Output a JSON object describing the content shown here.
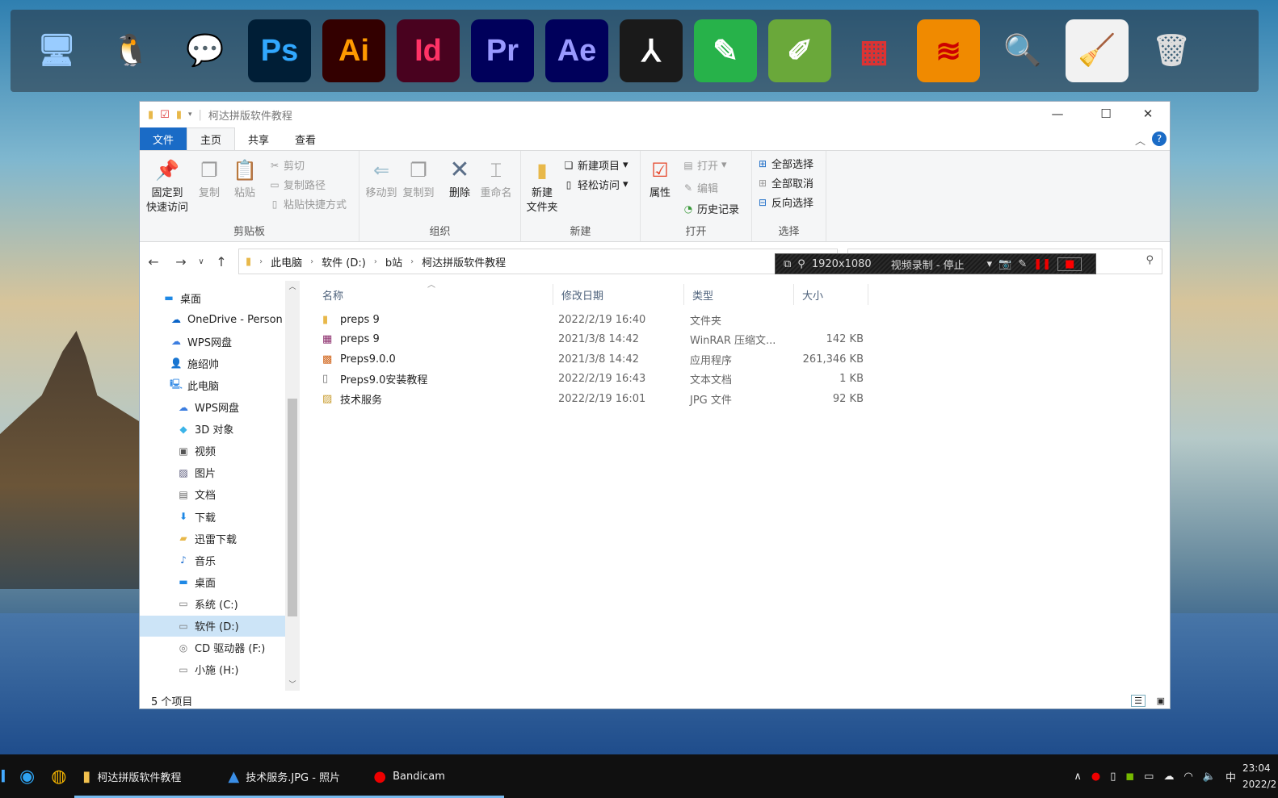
{
  "dock": {
    "icons": [
      {
        "name": "computer-icon",
        "glyph": "🖥",
        "bg": "transparent",
        "fg": "#9cf"
      },
      {
        "name": "qq-icon",
        "glyph": "🐧",
        "bg": "transparent",
        "fg": "#000"
      },
      {
        "name": "wechat-icon",
        "glyph": "💬",
        "bg": "transparent",
        "fg": "#2dc100"
      },
      {
        "name": "photoshop-icon",
        "glyph": "Ps",
        "bg": "#001e36",
        "fg": "#31a8ff"
      },
      {
        "name": "illustrator-icon",
        "glyph": "Ai",
        "bg": "#330000",
        "fg": "#ff9a00"
      },
      {
        "name": "indesign-icon",
        "glyph": "Id",
        "bg": "#49021f",
        "fg": "#ff3366"
      },
      {
        "name": "premiere-icon",
        "glyph": "Pr",
        "bg": "#00005b",
        "fg": "#9999ff"
      },
      {
        "name": "after-effects-icon",
        "glyph": "Ae",
        "bg": "#00005b",
        "fg": "#9999ff"
      },
      {
        "name": "acrobat-icon",
        "glyph": "⅄",
        "bg": "#1a1a1a",
        "fg": "#fff"
      },
      {
        "name": "green-pen-app-icon",
        "glyph": "✎",
        "bg": "#27b24a",
        "fg": "#fff"
      },
      {
        "name": "coreldraw-icon",
        "glyph": "✐",
        "bg": "#6aa83a",
        "fg": "#fff"
      },
      {
        "name": "windows-tiles-icon",
        "glyph": "▦",
        "bg": "transparent",
        "fg": "#d33"
      },
      {
        "name": "painting-app-icon",
        "glyph": "≋",
        "bg": "#f08a00",
        "fg": "#c00"
      },
      {
        "name": "magnifier-icon",
        "glyph": "🔍",
        "bg": "transparent",
        "fg": "#ccc"
      },
      {
        "name": "cleaner-icon",
        "glyph": "🧹",
        "bg": "#f2f2f2",
        "fg": "#6a3"
      },
      {
        "name": "trash-icon",
        "glyph": "🗑",
        "bg": "transparent",
        "fg": "#ddd"
      }
    ]
  },
  "window": {
    "title": "柯达拼版软件教程",
    "tabs": [
      "文件",
      "主页",
      "共享",
      "查看"
    ],
    "ribbon": {
      "clipboard": {
        "label": "剪贴板",
        "pin": "固定到",
        "pin2": "快速访问",
        "copy": "复制",
        "paste": "粘贴",
        "cut": "剪切",
        "copy_path": "复制路径",
        "paste_shortcut": "粘贴快捷方式"
      },
      "organize": {
        "label": "组织",
        "move_to": "移动到",
        "copy_to": "复制到",
        "delete": "删除",
        "rename": "重命名"
      },
      "new": {
        "label": "新建",
        "new_folder": "新建",
        "new_folder2": "文件夹",
        "new_item": "新建项目",
        "easy_access": "轻松访问"
      },
      "open": {
        "label": "打开",
        "properties": "属性",
        "open": "打开",
        "edit": "编辑",
        "history": "历史记录"
      },
      "select": {
        "label": "选择",
        "select_all": "全部选择",
        "select_none": "全部取消",
        "invert": "反向选择"
      }
    },
    "breadcrumb": [
      "此电脑",
      "软件 (D:)",
      "b站",
      "柯达拼版软件教程"
    ],
    "bandicam": {
      "resolution": "1920x1080",
      "status": "视频录制 - 停止"
    },
    "nav": [
      {
        "label": "桌面",
        "icon": "desktop-icon",
        "g": "▬",
        "c": "#1e88e5",
        "indent": 0
      },
      {
        "label": "OneDrive - Person",
        "icon": "onedrive-icon",
        "g": "☁",
        "c": "#0a64c8",
        "indent": 1
      },
      {
        "label": "WPS网盘",
        "icon": "wps-cloud-icon",
        "g": "☁",
        "c": "#3b7de0",
        "indent": 1
      },
      {
        "label": "施绍帅",
        "icon": "user-icon",
        "g": "👤",
        "c": "#d9a441",
        "indent": 1
      },
      {
        "label": "此电脑",
        "icon": "pc-icon",
        "g": "🖳",
        "c": "#3a8ee6",
        "indent": 1
      },
      {
        "label": "WPS网盘",
        "icon": "wps-cloud-icon",
        "g": "☁",
        "c": "#3b7de0",
        "indent": 2
      },
      {
        "label": "3D 对象",
        "icon": "3d-objects-icon",
        "g": "◆",
        "c": "#3bb4e8",
        "indent": 2
      },
      {
        "label": "视频",
        "icon": "videos-icon",
        "g": "▣",
        "c": "#555",
        "indent": 2
      },
      {
        "label": "图片",
        "icon": "pictures-icon",
        "g": "▨",
        "c": "#557",
        "indent": 2
      },
      {
        "label": "文档",
        "icon": "documents-icon",
        "g": "▤",
        "c": "#666",
        "indent": 2
      },
      {
        "label": "下载",
        "icon": "downloads-icon",
        "g": "⬇",
        "c": "#1e88e5",
        "indent": 2
      },
      {
        "label": "迅雷下载",
        "icon": "folder-icon",
        "g": "▰",
        "c": "#e8b84a",
        "indent": 2
      },
      {
        "label": "音乐",
        "icon": "music-icon",
        "g": "♪",
        "c": "#1e6fd0",
        "indent": 2
      },
      {
        "label": "桌面",
        "icon": "desktop-icon",
        "g": "▬",
        "c": "#1e88e5",
        "indent": 2
      },
      {
        "label": "系统 (C:)",
        "icon": "drive-icon",
        "g": "▭",
        "c": "#777",
        "indent": 2
      },
      {
        "label": "软件 (D:)",
        "icon": "drive-icon",
        "g": "▭",
        "c": "#777",
        "indent": 2,
        "selected": true
      },
      {
        "label": "CD 驱动器 (F:)",
        "icon": "cd-drive-icon",
        "g": "◎",
        "c": "#777",
        "indent": 2
      },
      {
        "label": "小施 (H:)",
        "icon": "drive-icon",
        "g": "▭",
        "c": "#777",
        "indent": 2
      }
    ],
    "columns": [
      "名称",
      "修改日期",
      "类型",
      "大小"
    ],
    "files": [
      {
        "name": "preps 9",
        "date": "2022/2/19 16:40",
        "type": "文件夹",
        "size": "",
        "icon": "folder-icon",
        "g": "▮",
        "c": "#e8b84a"
      },
      {
        "name": "preps 9",
        "date": "2021/3/8 14:42",
        "type": "WinRAR 压缩文...",
        "size": "142 KB",
        "icon": "winrar-icon",
        "g": "▦",
        "c": "#8a2a6a"
      },
      {
        "name": "Preps9.0.0",
        "date": "2021/3/8 14:42",
        "type": "应用程序",
        "size": "261,346 KB",
        "icon": "app-icon",
        "g": "▩",
        "c": "#d0641a"
      },
      {
        "name": "Preps9.0安装教程",
        "date": "2022/2/19 16:43",
        "type": "文本文档",
        "size": "1 KB",
        "icon": "text-file-icon",
        "g": "▯",
        "c": "#777"
      },
      {
        "name": "技术服务",
        "date": "2022/2/19 16:01",
        "type": "JPG 文件",
        "size": "92 KB",
        "icon": "image-file-icon",
        "g": "▨",
        "c": "#c79a2a"
      }
    ],
    "status": "5 个项目"
  },
  "taskbar": {
    "items": [
      {
        "label": "柯达拼版软件教程",
        "icon": "file-explorer-icon",
        "g": "▮",
        "c": "#f2c14e"
      },
      {
        "label": "技术服务.JPG - 照片",
        "icon": "photos-icon",
        "g": "▲",
        "c": "#3a8ee6"
      },
      {
        "label": "Bandicam",
        "icon": "bandicam-icon",
        "g": "●",
        "c": "#e00"
      }
    ],
    "ime": "中",
    "time": "23:04",
    "date": "2022/2"
  }
}
